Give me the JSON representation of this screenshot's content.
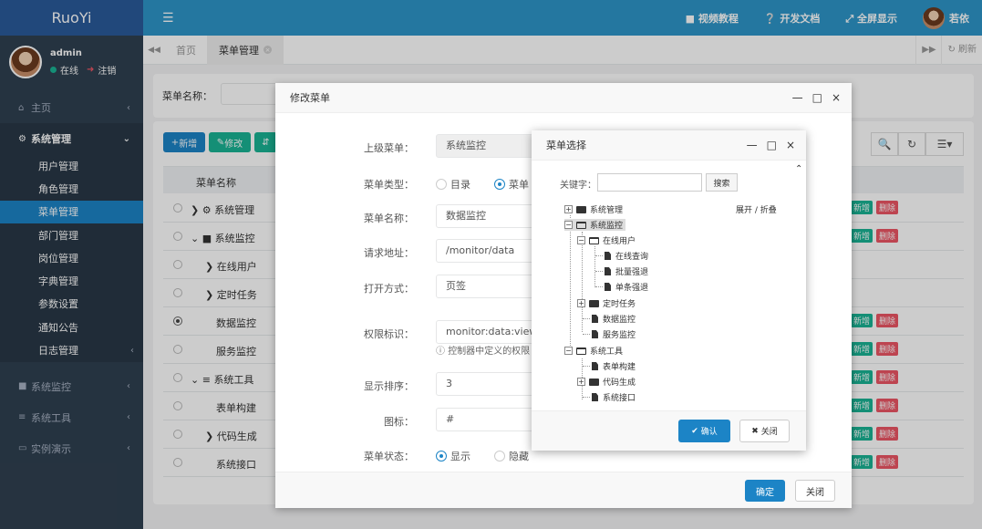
{
  "app": {
    "logo": "RuoYi"
  },
  "user": {
    "name": "admin",
    "status": "在线",
    "logout": "注销",
    "display_name": "若依"
  },
  "topbar": {
    "video": "视频教程",
    "docs": "开发文档",
    "fullscreen": "全屏显示"
  },
  "sidebar": {
    "home": "主页",
    "system": "系统管理",
    "sub_items": [
      "用户管理",
      "角色管理",
      "菜单管理",
      "部门管理",
      "岗位管理",
      "字典管理",
      "参数设置",
      "通知公告",
      "日志管理"
    ],
    "monitor": "系统监控",
    "tools": "系统工具",
    "demo": "实例演示"
  },
  "tabs": {
    "home": "首页",
    "menu": "菜单管理",
    "refresh": "刷新"
  },
  "search": {
    "menu_name_label": "菜单名称："
  },
  "table": {
    "add": "新增",
    "edit": "修改",
    "header_name": "菜单名称",
    "rows": [
      {
        "name": "系统管理",
        "ops": true
      },
      {
        "name": "系统监控",
        "ops": true
      },
      {
        "name": "在线用户",
        "ops": false
      },
      {
        "name": "定时任务",
        "ops": false
      },
      {
        "name": "数据监控",
        "ops": true
      },
      {
        "name": "服务监控",
        "ops": true
      },
      {
        "name": "系统工具",
        "ops": true
      },
      {
        "name": "表单构建",
        "ops": true
      },
      {
        "name": "代码生成",
        "ops": true
      },
      {
        "name": "系统接口",
        "ops": true
      }
    ],
    "op_add": "新增",
    "op_delete": "删除"
  },
  "edit_dialog": {
    "title": "修改菜单",
    "parent_label": "上级菜单：",
    "parent_value": "系统监控",
    "type_label": "菜单类型：",
    "type_dir": "目录",
    "type_menu": "菜单",
    "name_label": "菜单名称：",
    "name_value": "数据监控",
    "url_label": "请求地址：",
    "url_value": "/monitor/data",
    "open_label": "打开方式：",
    "open_value": "页签",
    "perm_label": "权限标识：",
    "perm_value": "monitor:data:view",
    "perm_hint": "控制器中定义的权限",
    "order_label": "显示排序：",
    "order_value": "3",
    "icon_label": "图标：",
    "icon_value": "#",
    "status_label": "菜单状态：",
    "status_show": "显示",
    "status_hide": "隐藏",
    "ok": "确定",
    "close": "关闭"
  },
  "menu_select": {
    "title": "菜单选择",
    "keyword_label": "关键字：",
    "search": "搜索",
    "expand": "展开 / 折叠",
    "tree": {
      "system": "系统管理",
      "monitor": "系统监控",
      "online": "在线用户",
      "online_query": "在线查询",
      "batch_logout": "批量强退",
      "single_logout": "单条强退",
      "job": "定时任务",
      "data": "数据监控",
      "server": "服务监控",
      "tools": "系统工具",
      "build": "表单构建",
      "gen": "代码生成",
      "swagger": "系统接口"
    },
    "ok": "确认",
    "close": "关闭"
  }
}
